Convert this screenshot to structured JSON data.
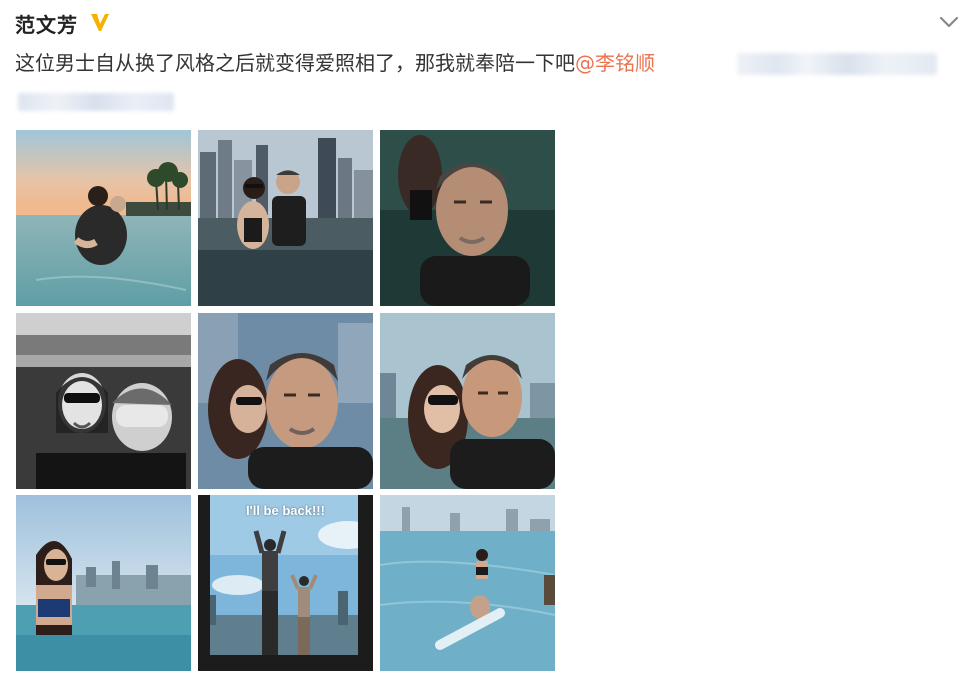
{
  "post": {
    "author": "范文芳",
    "verified_icon": "verified-v-icon",
    "menu_icon": "chevron-down-icon",
    "text": "这位男士自从换了风格之后就变得爱照相了，那我就奉陪一下吧",
    "mention": "@李铭顺",
    "photo_caption": "I'll be back!!!"
  },
  "colors": {
    "mention": "#eb7350",
    "verified": "#f5b000",
    "text": "#333333"
  }
}
